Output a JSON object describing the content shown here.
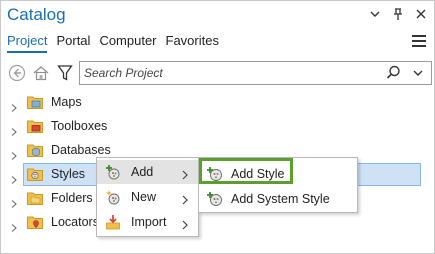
{
  "pane": {
    "title": "Catalog",
    "controls": {
      "options_icon": "chevron-down-icon",
      "pin_icon": "pin-icon",
      "close_icon": "close-icon"
    }
  },
  "tabs": [
    {
      "label": "Project",
      "active": true
    },
    {
      "label": "Portal",
      "active": false
    },
    {
      "label": "Computer",
      "active": false
    },
    {
      "label": "Favorites",
      "active": false
    }
  ],
  "toolbar": {
    "back_icon": "back-arrow-icon",
    "home_icon": "home-icon",
    "filter_icon": "filter-icon",
    "search_placeholder": "Search Project",
    "search_icon": "search-icon",
    "search_dropdown_icon": "chevron-down-icon"
  },
  "tree": [
    {
      "label": "Maps",
      "icon": "maps-folder-icon",
      "selected": false
    },
    {
      "label": "Toolboxes",
      "icon": "toolboxes-folder-icon",
      "selected": false
    },
    {
      "label": "Databases",
      "icon": "databases-folder-icon",
      "selected": false
    },
    {
      "label": "Styles",
      "icon": "styles-folder-icon",
      "selected": true
    },
    {
      "label": "Folders",
      "icon": "folders-folder-icon",
      "selected": false
    },
    {
      "label": "Locators",
      "icon": "locators-folder-icon",
      "selected": false
    }
  ],
  "context_menu": [
    {
      "label": "Add",
      "icon": "add-icon",
      "has_submenu": true,
      "highlighted": true
    },
    {
      "label": "New",
      "icon": "new-icon",
      "has_submenu": true,
      "highlighted": false
    },
    {
      "label": "Import",
      "icon": "import-icon",
      "has_submenu": true,
      "highlighted": false
    }
  ],
  "submenu": [
    {
      "label": "Add Style",
      "icon": "add-style-icon",
      "focused": true
    },
    {
      "label": "Add System Style",
      "icon": "add-system-style-icon",
      "focused": false
    }
  ],
  "colors": {
    "accent": "#1a6fb0",
    "selection": "#cfe2f5",
    "focus_outline": "#5b9f2c"
  }
}
